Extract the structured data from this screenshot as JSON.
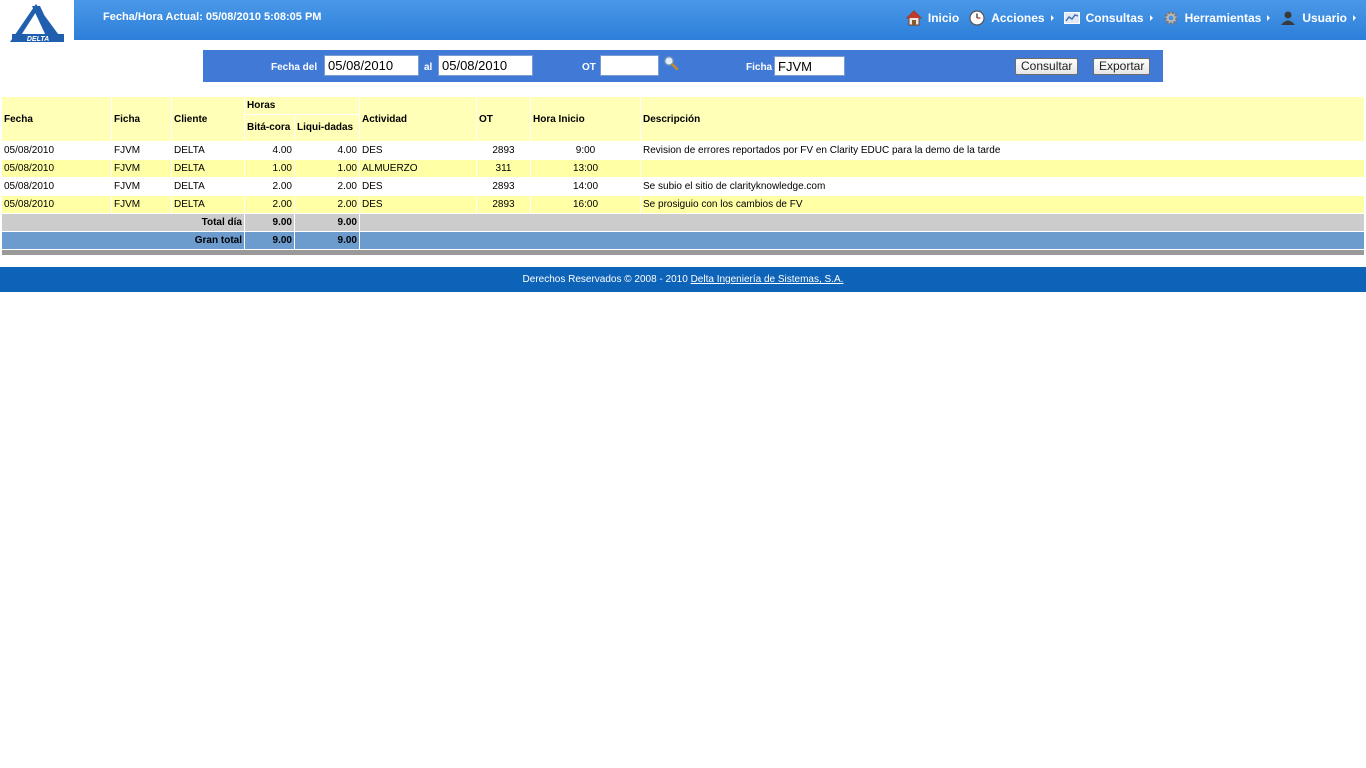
{
  "header": {
    "logo_text": "DELTA",
    "datetime": "Fecha/Hora Actual: 05/08/2010 5:08:05 PM",
    "menu": [
      {
        "label": "Inicio",
        "icon": "home-icon",
        "has_arrow": false
      },
      {
        "label": "Acciones",
        "icon": "clock-icon",
        "has_arrow": true
      },
      {
        "label": "Consultas",
        "icon": "chart-icon",
        "has_arrow": true
      },
      {
        "label": "Herramientas",
        "icon": "gear-icon",
        "has_arrow": true
      },
      {
        "label": "Usuario",
        "icon": "user-icon",
        "has_arrow": true
      }
    ]
  },
  "filter": {
    "fecha_del_label": "Fecha del",
    "fecha_del_value": "05/08/2010",
    "al_label": "al",
    "al_value": "05/08/2010",
    "ot_label": "OT",
    "ot_value": "",
    "ficha_label": "Ficha",
    "ficha_value": "FJVM",
    "consultar_label": "Consultar",
    "exportar_label": "Exportar"
  },
  "table": {
    "headers": {
      "fecha": "Fecha",
      "ficha": "Ficha",
      "cliente": "Cliente",
      "horas": "Horas",
      "bitacora": "Bitá-cora",
      "liquidadas": "Liqui-dadas",
      "actividad": "Actividad",
      "ot": "OT",
      "hora_inicio": "Hora Inicio",
      "descripcion": "Descripción"
    },
    "rows": [
      {
        "fecha": "05/08/2010",
        "ficha": "FJVM",
        "cliente": "DELTA",
        "bitacora": "4.00",
        "liquidadas": "4.00",
        "actividad": "DES",
        "ot": "2893",
        "hora_inicio": "9:00",
        "descripcion": "Revision de errores reportados por FV en Clarity EDUC para la demo de la tarde"
      },
      {
        "fecha": "05/08/2010",
        "ficha": "FJVM",
        "cliente": "DELTA",
        "bitacora": "1.00",
        "liquidadas": "1.00",
        "actividad": "ALMUERZO",
        "ot": "311",
        "hora_inicio": "13:00",
        "descripcion": ""
      },
      {
        "fecha": "05/08/2010",
        "ficha": "FJVM",
        "cliente": "DELTA",
        "bitacora": "2.00",
        "liquidadas": "2.00",
        "actividad": "DES",
        "ot": "2893",
        "hora_inicio": "14:00",
        "descripcion": "Se subio el sitio de clarityknowledge.com"
      },
      {
        "fecha": "05/08/2010",
        "ficha": "FJVM",
        "cliente": "DELTA",
        "bitacora": "2.00",
        "liquidadas": "2.00",
        "actividad": "DES",
        "ot": "2893",
        "hora_inicio": "16:00",
        "descripcion": "Se prosiguio con los cambios de FV"
      }
    ],
    "total_dia": {
      "label": "Total día",
      "bitacora": "9.00",
      "liquidadas": "9.00"
    },
    "gran_total": {
      "label": "Gran total",
      "bitacora": "9.00",
      "liquidadas": "9.00"
    }
  },
  "footer": {
    "text": "Derechos Reservados © 2008 - 2010",
    "link": "Delta Ingeniería de Sistemas, S.A."
  },
  "colors": {
    "header_blue": "#2c7fd9",
    "filter_blue": "#4179d6",
    "row_yellow": "#ffffa6",
    "header_yellow": "#ffffb8",
    "total_gray": "#cccccc",
    "grand_total_blue": "#6b9ccd",
    "footer_blue": "#0d63b8"
  }
}
